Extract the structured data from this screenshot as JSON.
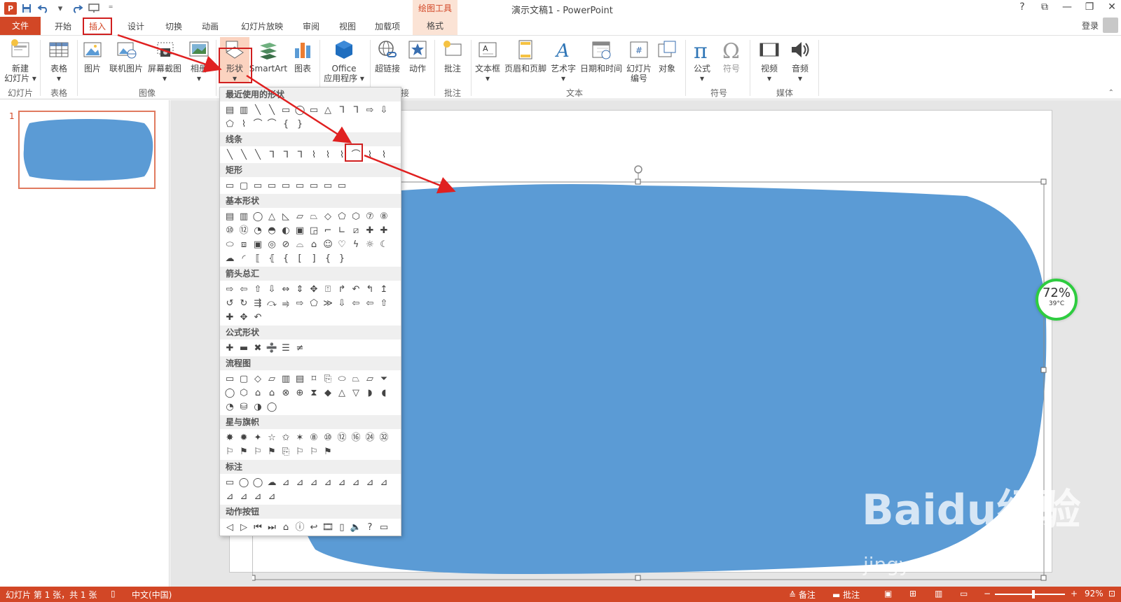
{
  "window": {
    "title": "演示文稿1 - PowerPoint",
    "contextual_tab_group": "绘图工具",
    "controls": [
      "?",
      "⧉",
      "—",
      "❐",
      "✕"
    ],
    "login": "登录"
  },
  "qat": {
    "logo": "P",
    "icons": [
      "save-icon",
      "undo-icon",
      "redo-icon",
      "present-icon",
      "customize-icon"
    ]
  },
  "tabs": [
    {
      "label": "文件",
      "state": "file"
    },
    {
      "label": "开始",
      "state": "normal"
    },
    {
      "label": "插入",
      "state": "active"
    },
    {
      "label": "设计",
      "state": "normal"
    },
    {
      "label": "切换",
      "state": "normal"
    },
    {
      "label": "动画",
      "state": "normal"
    },
    {
      "label": "幻灯片放映",
      "state": "normal"
    },
    {
      "label": "审阅",
      "state": "normal"
    },
    {
      "label": "视图",
      "state": "normal"
    },
    {
      "label": "加载项",
      "state": "normal"
    },
    {
      "label": "格式",
      "state": "contextual"
    }
  ],
  "ribbon": {
    "buttons": {
      "new_slide": "新建\n幻灯片 ▾",
      "table": "表格\n▾",
      "picture": "图片",
      "online_picture": "联机图片",
      "screenshot": "屏幕截图\n▾",
      "album": "相册\n▾",
      "shapes": "形状\n▾",
      "smartart": "SmartArt",
      "chart": "图表",
      "office_apps": "Office\n应用程序 ▾",
      "hyperlink": "超链接",
      "action": "动作",
      "comment": "批注",
      "textbox": "文本框\n▾",
      "header_footer": "页眉和页脚",
      "wordart": "艺术字\n▾",
      "datetime": "日期和时间",
      "slide_number": "幻灯片\n编号",
      "object": "对象",
      "equation": "公式\n▾",
      "symbol": "符号",
      "video": "视频\n▾",
      "audio": "音频\n▾"
    },
    "groups": {
      "slides": "幻灯片",
      "tables": "表格",
      "images": "图像",
      "links": "接",
      "comments": "批注",
      "text": "文本",
      "symbols": "符号",
      "media": "媒体"
    }
  },
  "thumbnails": {
    "slide_number": "1"
  },
  "gallery": {
    "sections": [
      {
        "title": "最近使用的形状",
        "shapes": [
          "▤",
          "▥",
          "╲",
          "╲",
          "▭",
          "◯",
          "▭",
          "△",
          "ᒣ",
          "ᒣ",
          "⇨",
          "⇩",
          "⬠",
          "⌇",
          "⌒",
          "⌒",
          "{",
          "}"
        ]
      },
      {
        "title": "线条",
        "shapes": [
          "╲",
          "╲",
          "╲",
          "ᒣ",
          "ᒣ",
          "ᒣ",
          "⌇",
          "⌇",
          "⌇",
          "⌒",
          "⌇",
          "⌇"
        ]
      },
      {
        "title": "矩形",
        "shapes": [
          "▭",
          "▢",
          "▭",
          "▭",
          "▭",
          "▭",
          "▭",
          "▭",
          "▭"
        ]
      },
      {
        "title": "基本形状",
        "shapes": [
          "▤",
          "▥",
          "◯",
          "△",
          "◺",
          "▱",
          "⏢",
          "◇",
          "⬠",
          "⬡",
          "⑦",
          "⑧",
          "⑩",
          "⑫",
          "◔",
          "◓",
          "◐",
          "▣",
          "◲",
          "⌐",
          "∟",
          "⧄",
          "✚",
          "✚",
          "⬭",
          "⧈",
          "▣",
          "◎",
          "⊘",
          "⌓",
          "⌂",
          "☺",
          "♡",
          "ϟ",
          "☼",
          "☾",
          "☁",
          "◜",
          "⟦",
          "⦃",
          "{",
          "[",
          "]",
          "{",
          "}"
        ]
      },
      {
        "title": "箭头总汇",
        "shapes": [
          "⇨",
          "⇦",
          "⇧",
          "⇩",
          "⇔",
          "⇕",
          "✥",
          "⍐",
          "↱",
          "↶",
          "↰",
          "↥",
          "↺",
          "↻",
          "⇶",
          "⤼",
          "⥤",
          "⇨",
          "⬠",
          "≫",
          "⇩",
          "⇦",
          "⇦",
          "⇧",
          "✚",
          "✥",
          "↶"
        ]
      },
      {
        "title": "公式形状",
        "shapes": [
          "✚",
          "▬",
          "✖",
          "➗",
          "☰",
          "≠"
        ]
      },
      {
        "title": "流程图",
        "shapes": [
          "▭",
          "▢",
          "◇",
          "▱",
          "▥",
          "▤",
          "⌑",
          "⎘",
          "⬭",
          "⏢",
          "⏥",
          "⏷",
          "◯",
          "⬡",
          "⌂",
          "⌂",
          "⊗",
          "⊕",
          "⧗",
          "◆",
          "△",
          "▽",
          "◗",
          "◖",
          "◔",
          "⛁",
          "◑",
          "◯"
        ]
      },
      {
        "title": "星与旗帜",
        "shapes": [
          "✸",
          "✹",
          "✦",
          "☆",
          "✩",
          "✶",
          "⑧",
          "⑩",
          "⑫",
          "⑯",
          "㉔",
          "㉜",
          "⚐",
          "⚑",
          "⚐",
          "⚑",
          "⎘",
          "⚐",
          "⚐",
          "⚑"
        ]
      },
      {
        "title": "标注",
        "shapes": [
          "▭",
          "◯",
          "◯",
          "☁",
          "⊿",
          "⊿",
          "⊿",
          "⊿",
          "⊿",
          "⊿",
          "⊿",
          "⊿",
          "⊿",
          "⊿",
          "⊿",
          "⊿"
        ]
      },
      {
        "title": "动作按钮",
        "shapes": [
          "◁",
          "▷",
          "⏮",
          "⏭",
          "⌂",
          "ⓘ",
          "↩",
          "🎞",
          "▯",
          "🔈",
          "?",
          "▭"
        ]
      }
    ]
  },
  "gauge": {
    "value": "72%",
    "temp": "39°C"
  },
  "watermark": {
    "brand": "Baidu经验",
    "url": "jingyan.baidu.com"
  },
  "statusbar": {
    "slide_info": "幻灯片 第 1 张，共 1 张",
    "language": "中文(中国)",
    "notes": "≙ 备注",
    "comments": "▬ 批注",
    "zoom": "92%",
    "zoom_level": 0.55
  },
  "colors": {
    "accent": "#d24726",
    "shape_fill": "#5b9bd5",
    "highlight_box": "#d01f1f",
    "arrow": "#e02020"
  }
}
